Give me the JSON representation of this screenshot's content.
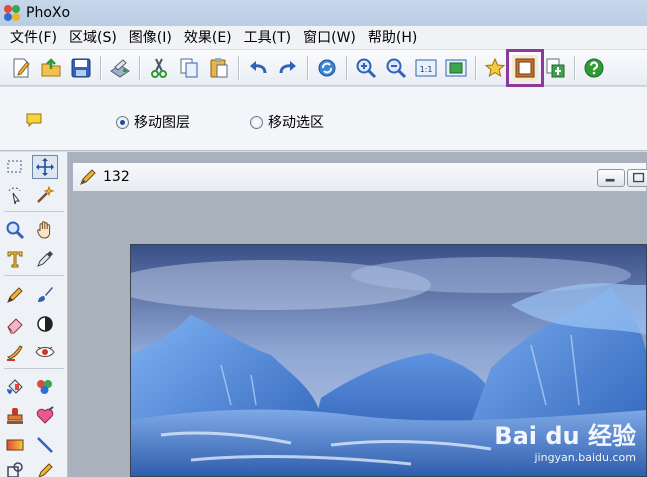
{
  "window": {
    "title": "PhoXo"
  },
  "menu": [
    "文件(F)",
    "区域(S)",
    "图像(I)",
    "效果(E)",
    "工具(T)",
    "窗口(W)",
    "帮助(H)"
  ],
  "toolbar": {
    "buttons": [
      "new-icon",
      "open-icon",
      "save-icon",
      "scan-icon",
      "cut-icon",
      "copy-icon",
      "paste-icon",
      "undo-icon",
      "redo-icon",
      "refresh-icon",
      "zoom-in-icon",
      "zoom-out-icon",
      "actual-size-icon",
      "fit-window-icon",
      "star-icon",
      "frame-icon",
      "export-icon",
      "help-icon"
    ],
    "actual_size_label": "1:1",
    "highlighted": "frame-icon",
    "highlight_color": "#8b3a9b"
  },
  "options": {
    "move_layer_label": "移动图层",
    "move_selection_label": "移动选区",
    "selected": "move_layer"
  },
  "document": {
    "title": "132"
  },
  "watermark": {
    "logo": "Bai du 经验",
    "url": "jingyan.baidu.com"
  }
}
